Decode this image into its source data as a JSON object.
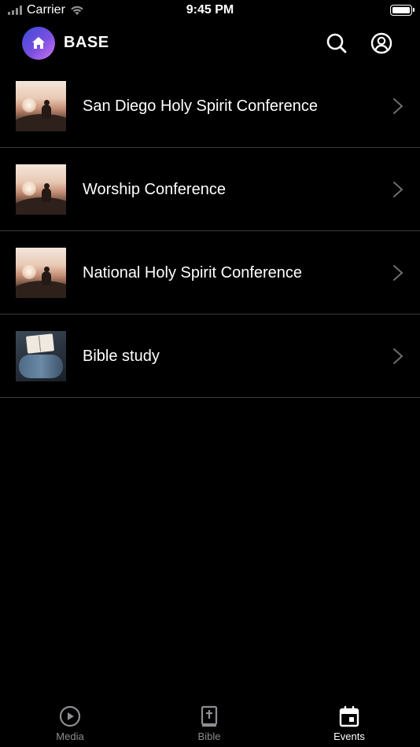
{
  "status_bar": {
    "carrier": "Carrier",
    "time": "9:45 PM",
    "battery_level": 1.0
  },
  "header": {
    "app_title": "BASE",
    "logo_icon": "home-icon",
    "actions": [
      {
        "icon": "search-icon"
      },
      {
        "icon": "account-icon"
      }
    ]
  },
  "events": [
    {
      "title": "San Diego Holy Spirit Conference",
      "thumbnail": "sunset-person"
    },
    {
      "title": "Worship Conference",
      "thumbnail": "sunset-person"
    },
    {
      "title": "National Holy Spirit Conference",
      "thumbnail": "sunset-person"
    },
    {
      "title": "Bible study",
      "thumbnail": "open-bible"
    }
  ],
  "tab_bar": {
    "tabs": [
      {
        "label": "Media",
        "icon": "play-circle-icon",
        "active": false
      },
      {
        "label": "Bible",
        "icon": "bible-icon",
        "active": false
      },
      {
        "label": "Events",
        "icon": "calendar-icon",
        "active": true
      }
    ]
  },
  "colors": {
    "background": "#000000",
    "text": "#ffffff",
    "separator": "#3a3a3c",
    "inactive_tab": "#8e8e93",
    "logo_gradient": [
      "#3a4bd8",
      "#7a4fe0",
      "#d178f2"
    ]
  }
}
